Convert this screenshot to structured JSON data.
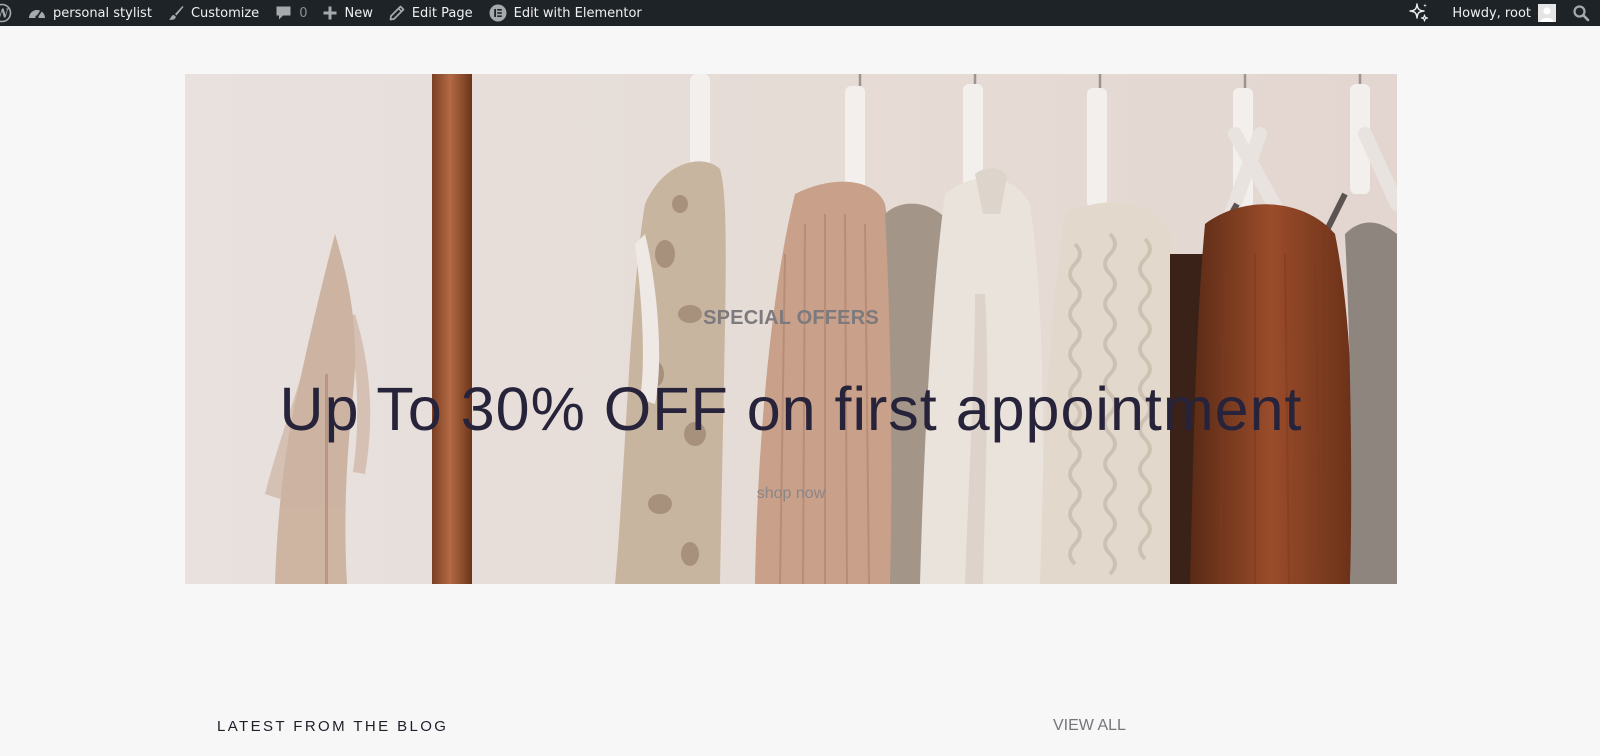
{
  "admin_bar": {
    "site_name": "personal stylist",
    "customize": "Customize",
    "comments_count": "0",
    "new": "New",
    "edit_page": "Edit Page",
    "edit_elementor": "Edit with Elementor",
    "howdy": "Howdy, root"
  },
  "hero": {
    "eyebrow": "SPECIAL OFFERS",
    "title": "Up To 30% OFF on first appointment",
    "link": "shop now"
  },
  "blog": {
    "heading": "LATEST FROM THE BLOG",
    "view_all": "VIEW ALL"
  },
  "colors": {
    "admin_bar_bg": "#1d2327",
    "page_bg": "#f7f7f7",
    "hero_title": "#27233a"
  }
}
